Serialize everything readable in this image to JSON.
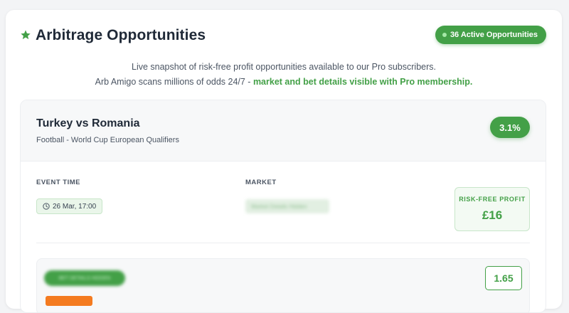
{
  "header": {
    "title": "Arbitrage Opportunities",
    "active_badge": "36 Active Opportunities"
  },
  "intro": {
    "line1": "Live snapshot of risk-free profit opportunities available to our Pro subscribers.",
    "line2_prefix": "Arb Amigo scans millions of odds 24/7 - ",
    "line2_highlight": "market and bet details visible with Pro membership."
  },
  "card": {
    "match": "Turkey vs Romania",
    "competition": "Football - World Cup European Qualifiers",
    "profit_pct": "3.1%",
    "event_time_label": "EVENT TIME",
    "event_time": "26 Mar, 17:00",
    "market_label": "MARKET",
    "market_hidden": "Market Details Hidden",
    "profit_label": "RISK-FREE PROFIT",
    "profit_value": "£16",
    "bet_hidden": "BET DETAILS HIDDEN",
    "odds": "1.65"
  },
  "colors": {
    "accent": "#43a047",
    "orange": "#f47b20"
  }
}
